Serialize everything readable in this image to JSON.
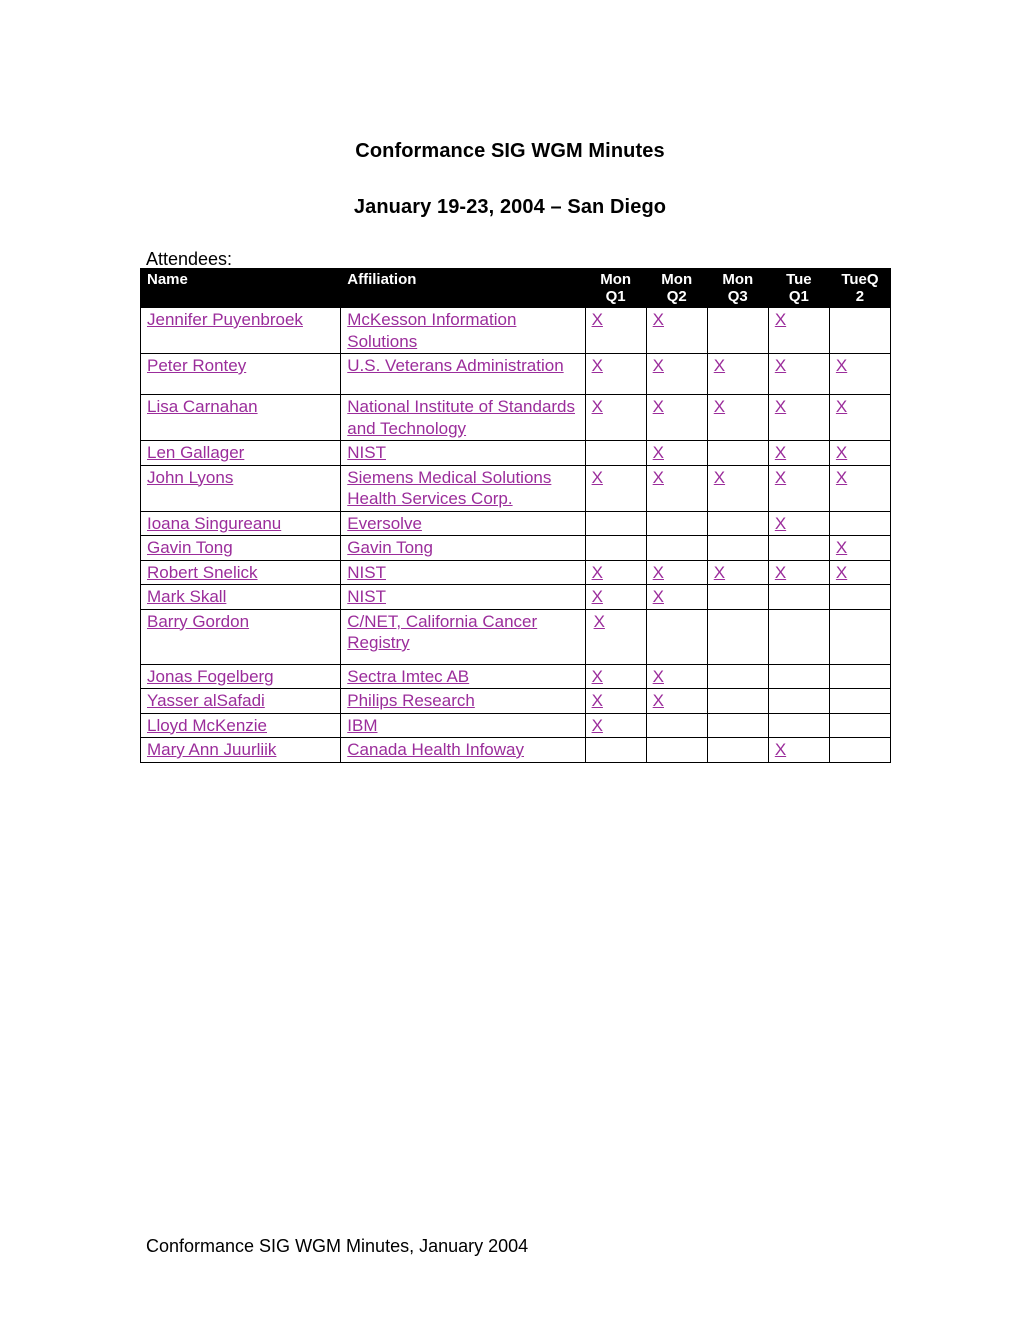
{
  "document": {
    "title": "Conformance SIG WGM Minutes",
    "subtitle": "January 19-23, 2004 – San Diego",
    "attendees_label": "Attendees:",
    "footer": "Conformance SIG WGM Minutes, January 2004",
    "link_color": "#9B2D9B",
    "header_bg": "#000000",
    "header_fg": "#FFFFFF"
  },
  "table": {
    "columns": [
      {
        "key": "name",
        "label": "Name"
      },
      {
        "key": "affil",
        "label": "Affiliation"
      },
      {
        "key": "monq1",
        "label": "Mon Q1"
      },
      {
        "key": "monq2",
        "label": "Mon Q2"
      },
      {
        "key": "monq3",
        "label": "Mon Q3"
      },
      {
        "key": "tueq1",
        "label": "Tue Q1"
      },
      {
        "key": "tueq2",
        "label": "TueQ 2"
      }
    ],
    "column_labels_line1": [
      "Name",
      "Affiliation",
      "Mon",
      "Mon",
      "Mon",
      "Tue",
      "TueQ"
    ],
    "column_labels_line2": [
      "",
      "",
      "Q1",
      "Q2",
      "Q3",
      "Q1",
      "2"
    ],
    "mark": "X",
    "rows": [
      {
        "name": "Jennifer Puyenbroek",
        "affil": "McKesson Information Solutions",
        "monq1": "X",
        "monq2": "X",
        "monq3": "",
        "tueq1": "X",
        "tueq2": ""
      },
      {
        "name": "Peter Rontey",
        "affil": "U.S. Veterans Administration",
        "monq1": "X",
        "monq2": "X",
        "monq3": "X",
        "tueq1": "X",
        "tueq2": "X"
      },
      {
        "name": "Lisa Carnahan",
        "affil": "National Institute of Standards and Technology",
        "monq1": "X",
        "monq2": "X",
        "monq3": "X",
        "tueq1": "X",
        "tueq2": "X"
      },
      {
        "name": "Len Gallager ",
        "affil": "NIST",
        "monq1": "",
        "monq2": "X",
        "monq3": "",
        "tueq1": "X",
        "tueq2": "X"
      },
      {
        "name": "John Lyons",
        "affil": "Siemens Medical Solutions Health Services Corp.",
        "monq1": "X",
        "monq2": "X",
        "monq3": "X",
        "tueq1": "X",
        "tueq2": "X"
      },
      {
        "name": "Ioana Singureanu",
        "affil": "Eversolve",
        "monq1": "",
        "monq2": "",
        "monq3": "",
        "tueq1": "X",
        "tueq2": ""
      },
      {
        "name": "Gavin Tong",
        "affil": "Gavin Tong",
        "monq1": "",
        "monq2": "",
        "monq3": "",
        "tueq1": "",
        "tueq2": "X"
      },
      {
        "name": "Robert Snelick",
        "affil": "NIST",
        "monq1": "X",
        "monq2": "X",
        "monq3": "X",
        "tueq1": "X",
        "tueq2": "X"
      },
      {
        "name": "Mark Skall",
        "affil": "NIST",
        "monq1": "X",
        "monq2": "X",
        "monq3": "",
        "tueq1": "",
        "tueq2": ""
      },
      {
        "name": "Barry Gordon",
        "affil": "C/NET, California Cancer Registry",
        "monq1": "X",
        "monq2": "",
        "monq3": "",
        "tueq1": "",
        "tueq2": ""
      },
      {
        "name": "Jonas Fogelberg",
        "affil": "Sectra Imtec AB",
        "monq1": "X",
        "monq2": "X",
        "monq3": "",
        "tueq1": "",
        "tueq2": ""
      },
      {
        "name": "Yasser alSafadi",
        "affil": "Philips Research",
        "monq1": "X",
        "monq2": "X",
        "monq3": "",
        "tueq1": "",
        "tueq2": ""
      },
      {
        "name": "Lloyd McKenzie",
        "affil": "IBM",
        "monq1": "X",
        "monq2": "",
        "monq3": "",
        "tueq1": "",
        "tueq2": ""
      },
      {
        "name": "Mary Ann Juurliik",
        "affil": "Canada Health Infoway",
        "monq1": "",
        "monq2": "",
        "monq3": "",
        "tueq1": "X",
        "tueq2": ""
      }
    ]
  }
}
